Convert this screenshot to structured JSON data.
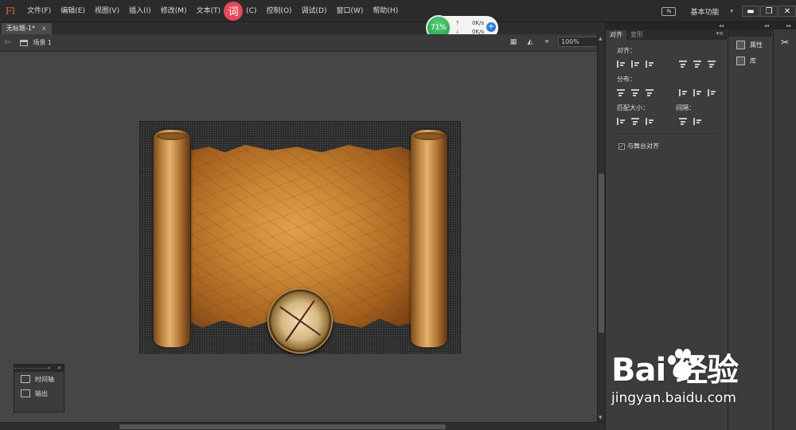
{
  "app": {
    "logo": "Fl"
  },
  "menu": {
    "items": [
      "文件(F)",
      "编辑(E)",
      "视图(V)",
      "插入(I)",
      "修改(M)",
      "文本(T)"
    ],
    "dict_badge": "词",
    "items_after": [
      "(C)",
      "控制(O)",
      "调试(D)",
      "窗口(W)",
      "帮助(H)"
    ],
    "workspace": "基本功能"
  },
  "document": {
    "tab_title": "无标题-1*",
    "close": "×",
    "scene": "场景 1"
  },
  "zoom": {
    "value": "100%"
  },
  "speed_widget": {
    "percent": "71%",
    "upload": "0K/s",
    "download": "0K/s"
  },
  "floating_panel": {
    "items": [
      "时间轴",
      "输出"
    ]
  },
  "align_panel": {
    "tabs": [
      "对齐",
      "变形"
    ],
    "align_label": "对齐：",
    "distribute_label": "分布：",
    "match_size_label": "匹配大小：",
    "spacing_label": "间隔：",
    "align_to_stage": "与舞台对齐"
  },
  "props_dock": {
    "items": [
      "属性",
      "库"
    ]
  },
  "watermark": {
    "brand": "Bai  经验",
    "url": "jingyan.baidu.com"
  },
  "colors": {
    "accent": "#e0663a",
    "dict_badge": "#e8485b",
    "speed_green": "#1e9a45"
  }
}
